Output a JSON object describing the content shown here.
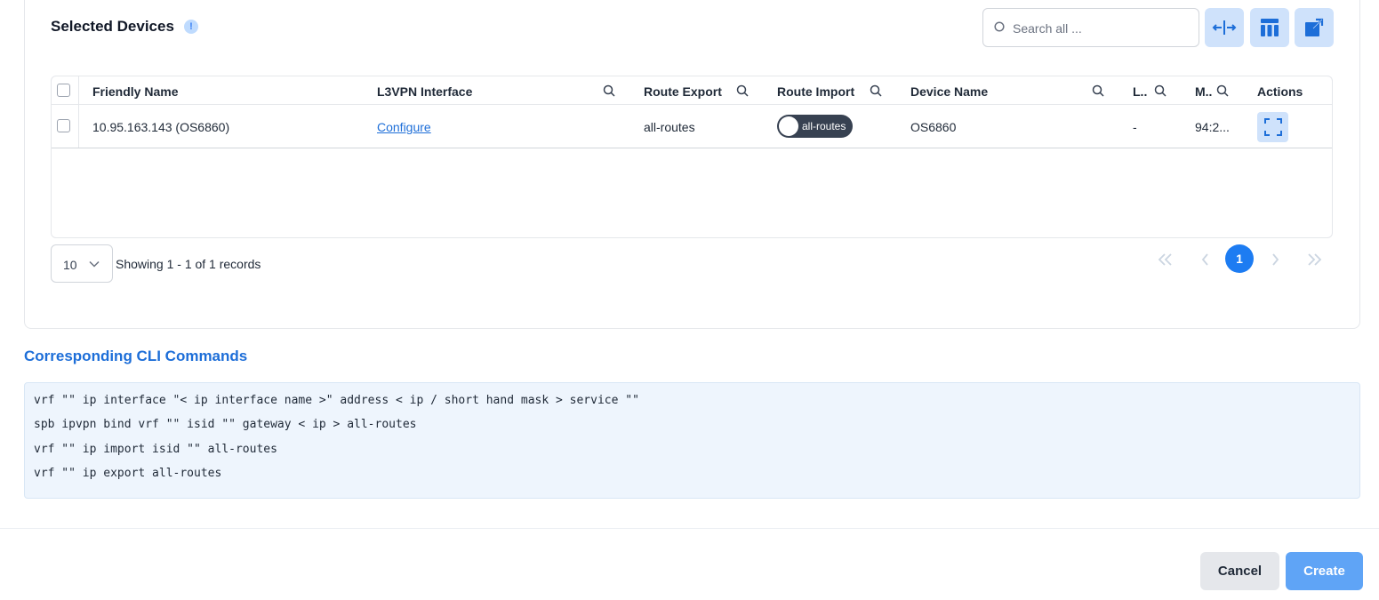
{
  "section": {
    "title": "Selected Devices",
    "info_icon": "info-icon",
    "search": {
      "placeholder": "Search all ...",
      "value": ""
    },
    "toolbar": {
      "icons": [
        "expand-columns-icon",
        "column-layout-icon",
        "open-external-icon"
      ]
    }
  },
  "table": {
    "columns": [
      "Friendly Name",
      "L3VPN Interface",
      "Route Export",
      "Route Import",
      "Device Name",
      "L..",
      "M..",
      "Actions"
    ],
    "rows": [
      {
        "friendly_name": "10.95.163.143 (OS6860)",
        "l3vpn_interface": "Configure",
        "route_export": "all-routes",
        "route_import": "all-routes",
        "device_name": "OS6860",
        "l": "-",
        "m": "94:2...",
        "action_icon": "fullscreen-icon"
      }
    ]
  },
  "pagination": {
    "page_size": "10",
    "records_text": "Showing 1 - 1 of 1 records",
    "current_page": "1"
  },
  "cli": {
    "title": "Corresponding CLI Commands",
    "lines": [
      "vrf \"\" ip interface \"< ip interface name >\" address < ip / short hand mask > service \"\"",
      "spb ipvpn bind vrf \"\" isid \"\" gateway < ip > all-routes",
      "vrf \"\" ip import isid \"\" all-routes",
      "vrf \"\" ip export all-routes"
    ]
  },
  "footer": {
    "cancel_label": "Cancel",
    "create_label": "Create"
  },
  "colors": {
    "accent": "#1d7cf2",
    "tool_bg": "#cfe2fb",
    "cli_bg": "#eef5fd",
    "toggle_bg": "#374151"
  }
}
